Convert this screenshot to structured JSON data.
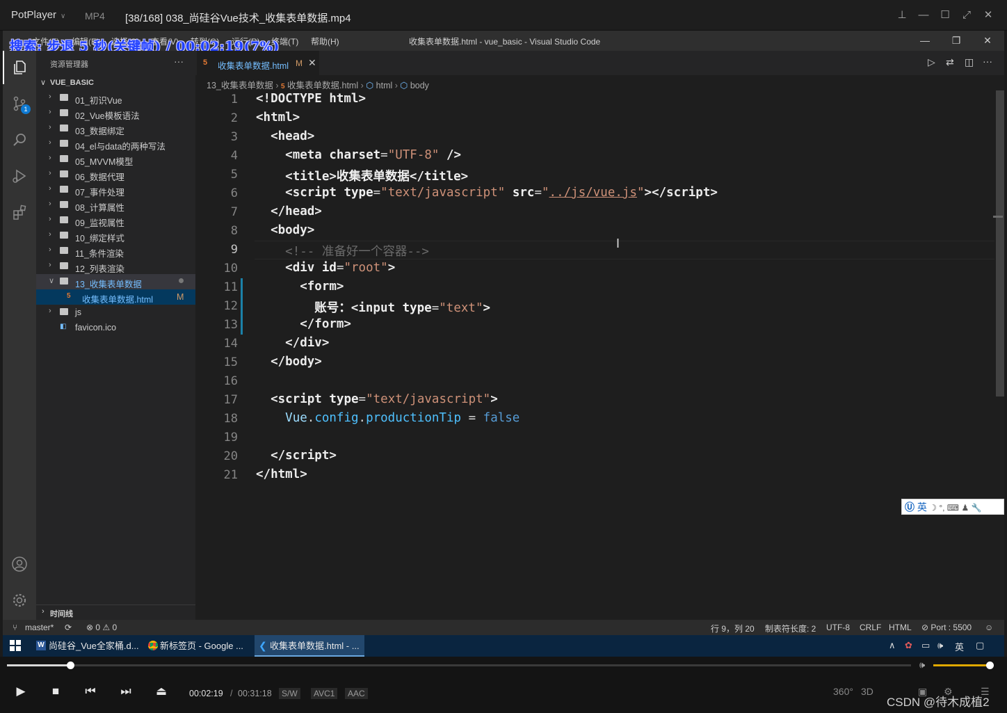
{
  "player": {
    "app_name": "PotPlayer",
    "format": "MP4",
    "file_title": "[38/168] 038_尚硅谷Vue技术_收集表单数据.mp4",
    "osd_text": "搜索: 步退 5 秒(关键帧) / 00:02:19(7%)",
    "time_current": "00:02:19",
    "time_separator": "/",
    "time_total": "00:31:18",
    "progress_fraction": 0.07,
    "tags": [
      "S/W",
      "AVC1",
      "AAC"
    ],
    "right_buttons": [
      "360°",
      "3D"
    ],
    "watermark": "CSDN @待木成植2"
  },
  "vscode": {
    "menus": [
      "文件(F)",
      "编辑(E)",
      "选择(S)",
      "查看(V)",
      "转到(G)",
      "运行(R)",
      "终端(T)",
      "帮助(H)"
    ],
    "window_title": "收集表单数据.html - vue_basic - Visual Studio Code",
    "explorer_title": "资源管理器",
    "root_folder": "VUE_BASIC",
    "tree": [
      {
        "label": "01_初识Vue",
        "type": "folder"
      },
      {
        "label": "02_Vue模板语法",
        "type": "folder"
      },
      {
        "label": "03_数据绑定",
        "type": "folder"
      },
      {
        "label": "04_el与data的两种写法",
        "type": "folder"
      },
      {
        "label": "05_MVVM模型",
        "type": "folder"
      },
      {
        "label": "06_数据代理",
        "type": "folder"
      },
      {
        "label": "07_事件处理",
        "type": "folder"
      },
      {
        "label": "08_计算属性",
        "type": "folder"
      },
      {
        "label": "09_监视属性",
        "type": "folder"
      },
      {
        "label": "10_绑定样式",
        "type": "folder"
      },
      {
        "label": "11_条件渲染",
        "type": "folder"
      },
      {
        "label": "12_列表渲染",
        "type": "folder"
      },
      {
        "label": "13_收集表单数据",
        "type": "folder-open"
      },
      {
        "label": "收集表单数据.html",
        "type": "file",
        "badge": "M"
      },
      {
        "label": "js",
        "type": "folder"
      },
      {
        "label": "favicon.ico",
        "type": "file-plain"
      }
    ],
    "timeline_label": "时间线",
    "tab_name": "收集表单数据.html",
    "tab_badge": "M",
    "breadcrumb": [
      "13_收集表单数据",
      "收集表单数据.html",
      "html",
      "body"
    ],
    "scm_badge": "1",
    "line_numbers": [
      "1",
      "2",
      "3",
      "4",
      "5",
      "6",
      "7",
      "8",
      "9",
      "10",
      "11",
      "12",
      "13",
      "14",
      "15",
      "16",
      "17",
      "18",
      "19",
      "20",
      "21"
    ],
    "status": {
      "branch": "master*",
      "problems": "⊗ 0 ⚠ 0",
      "position": "行 9，列 20",
      "tab_size": "制表符长度: 2",
      "encoding": "UTF-8",
      "eol": "CRLF",
      "language": "HTML",
      "port": "⊘ Port : 5500"
    },
    "ime_text": "英"
  },
  "taskbar": {
    "items": [
      "尚硅谷_Vue全家桶.d...",
      "新标签页 - Google ...",
      "收集表单数据.html - ..."
    ],
    "tray_lang": "英"
  }
}
